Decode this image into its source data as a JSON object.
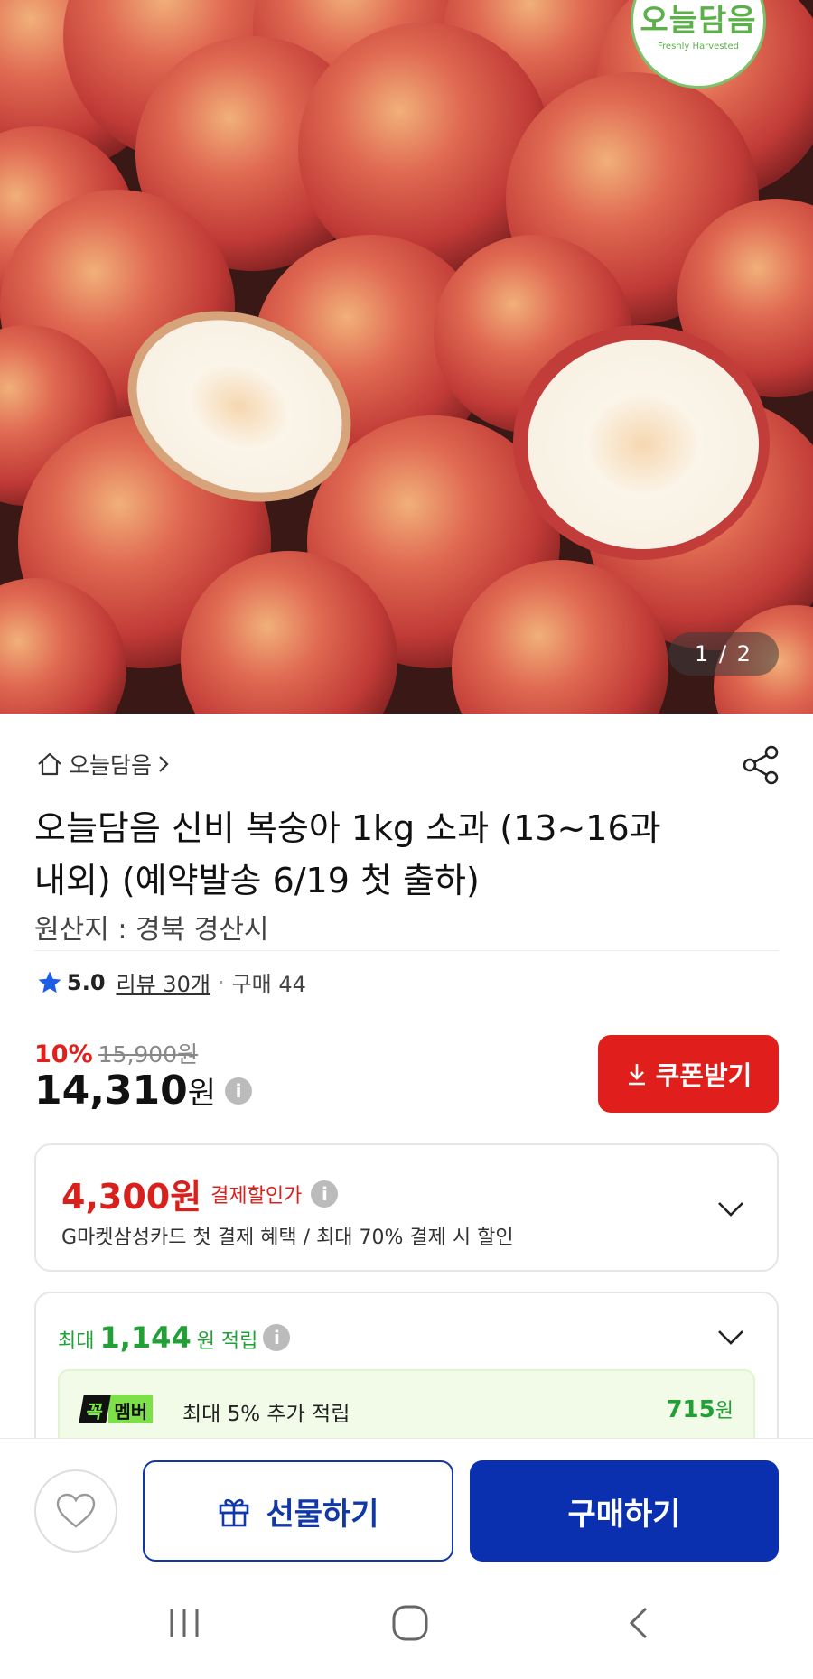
{
  "hero": {
    "brand_logo_text": "오늘담음",
    "brand_logo_sub": "Freshly Harvested",
    "image_counter": "1 / 2"
  },
  "product": {
    "store_name": "오늘담음",
    "title": "오늘담음 신비 복숭아 1kg 소과 (13~16과 내외) (예약발송 6/19 첫 출하)",
    "origin": "원산지 : 경북 경산시",
    "rating": "5.0",
    "review_label": "리뷰 30개",
    "purchase_label": "구매 44"
  },
  "pricing": {
    "discount_rate": "10%",
    "original_price": "15,900",
    "original_unit": "원",
    "sale_price": "14,310",
    "sale_unit": "원",
    "coupon_button": "쿠폰받기"
  },
  "payment_discount": {
    "amount": "4,300원",
    "label": "결제할인가",
    "description": "G마켓삼성카드 첫 결제 혜택 / 최대 70% 결제 시 할인"
  },
  "points": {
    "prefix": "최대",
    "amount": "1,144",
    "suffix": "원 적립",
    "member_badge_1": "꼭",
    "member_badge_2": "멤버",
    "member_text": "최대 5% 추가 적립",
    "member_amount": "715",
    "member_unit": "원"
  },
  "actions": {
    "gift_button": "선물하기",
    "buy_button": "구매하기"
  },
  "colors": {
    "accent_red": "#e01f1c",
    "accent_blue": "#0a30b0",
    "accent_green": "#21a135"
  }
}
